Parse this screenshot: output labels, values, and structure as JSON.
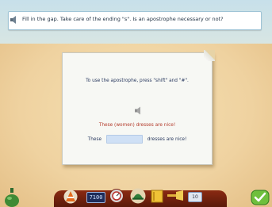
{
  "instruction": {
    "text": "Fill in the gap. Take care of the ending \"s\". Is an apostrophe necessary or not?"
  },
  "exercise": {
    "hint": "To use the apostrophe, press \"shift\" and \"#\".",
    "example_sentence": "These (women) dresses are nice!",
    "gap_before": "These",
    "gap_after": "dresses are nice!",
    "gap_value": ""
  },
  "toolbar": {
    "score": "7100",
    "page": "10"
  },
  "colors": {
    "sentence_red": "#b33a2a",
    "text_blue": "#2a3a60",
    "gap_fill": "#cfe0f5"
  }
}
